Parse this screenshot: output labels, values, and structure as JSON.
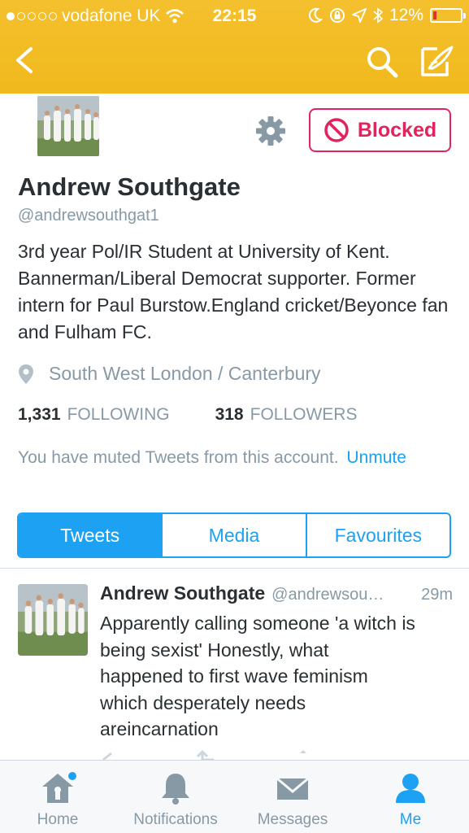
{
  "status_bar": {
    "carrier": "vodafone UK",
    "time": "22:15",
    "battery_text": "12%",
    "battery_level": 0.12,
    "battery_color": "#e0322b"
  },
  "nav": {
    "back_icon": "chevron-left-icon",
    "search_icon": "search-icon",
    "compose_icon": "compose-icon"
  },
  "profile": {
    "name": "Andrew Southgate",
    "handle": "@andrewsouthgat1",
    "bio": "3rd year Pol/IR Student at University of Kent. Bannerman/Liberal Democrat supporter. Former intern for Paul Burstow.England cricket/Beyonce fan and Fulham FC.",
    "location": "South West London / Canterbury",
    "following_count": "1,331",
    "following_label": "FOLLOWING",
    "followers_count": "318",
    "followers_label": "FOLLOWERS",
    "blocked_label": "Blocked",
    "muted_text": "You have muted Tweets from this account.",
    "unmute_label": "Unmute"
  },
  "tabs": [
    {
      "label": "Tweets",
      "active": true
    },
    {
      "label": "Media",
      "active": false
    },
    {
      "label": "Favourites",
      "active": false
    }
  ],
  "tweet": {
    "name": "Andrew Southgate",
    "handle": "@andrewsou…",
    "time": "29m",
    "text": "Apparently calling someone 'a witch is\nbeing sexist'  Honestly, what\nhappened to  first wave feminism\nwhich desperately needs\nareincarnation"
  },
  "tabbar": [
    {
      "label": "Home",
      "icon": "home-icon",
      "active": false
    },
    {
      "label": "Notifications",
      "icon": "bell-icon",
      "active": false
    },
    {
      "label": "Messages",
      "icon": "envelope-icon",
      "active": false
    },
    {
      "label": "Me",
      "icon": "person-icon",
      "active": true
    }
  ],
  "colors": {
    "header": "#f0b91d",
    "accent": "#1da1f2",
    "blocked": "#e0245e",
    "muted_text": "#8899a6"
  }
}
